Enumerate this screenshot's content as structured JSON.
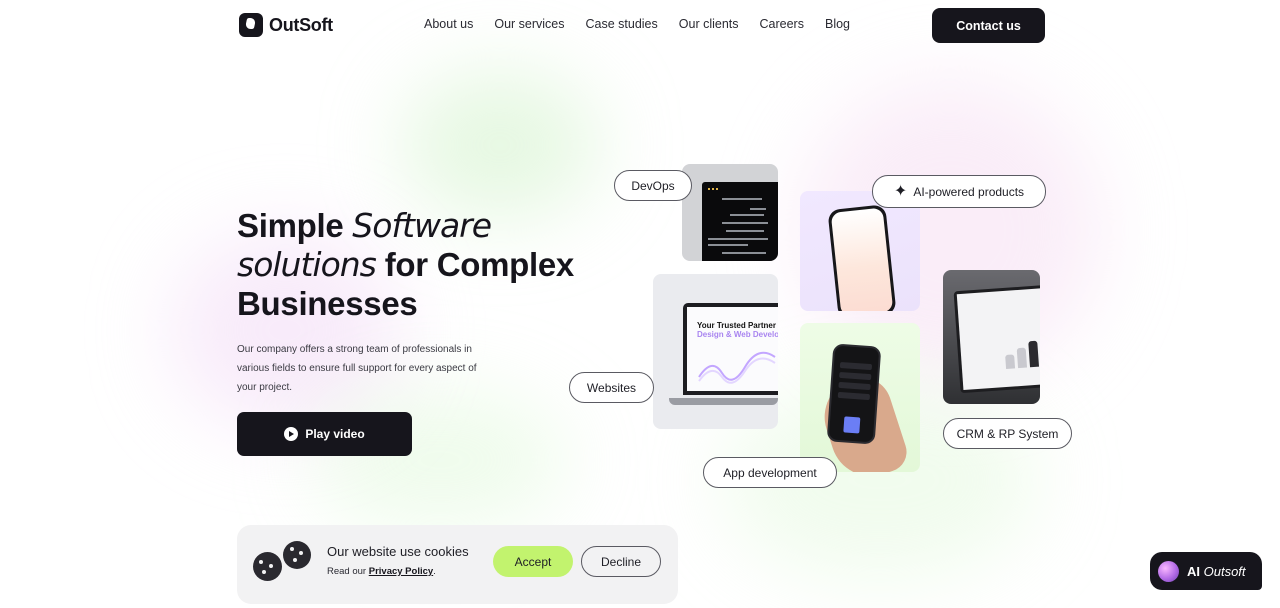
{
  "header": {
    "logo_text": "OutSoft",
    "nav": [
      "About us",
      "Our services",
      "Case studies",
      "Our clients",
      "Careers",
      "Blog"
    ],
    "contact_label": "Contact us"
  },
  "hero": {
    "title_part1": "Simple ",
    "title_italic1": "Software",
    "title_italic2": "solutions",
    "title_part2": " for Complex",
    "title_part3": "Businesses",
    "description": "Our company offers a strong team of professionals in various fields to ensure full support for every aspect of your project.",
    "play_label": "Play video"
  },
  "services": {
    "devops": "DevOps",
    "ai": "AI-powered products",
    "websites": "Websites",
    "app": "App development",
    "crm": "CRM & RP System",
    "web_card_line1": "Your Trusted Partner",
    "web_card_line2a": "Design",
    "web_card_line2b": " & Web ",
    "web_card_line2c": "Develo"
  },
  "cookie": {
    "title": "Our website use cookies",
    "text": "Read our",
    "policy_link": "Privacy Policy",
    "period": ".",
    "accept": "Accept",
    "decline": "Decline"
  },
  "ai_chat": {
    "ai": "AI",
    "brand": "Outsoft"
  },
  "colors": {
    "dark": "#16151c",
    "accept": "#c2f36e"
  }
}
